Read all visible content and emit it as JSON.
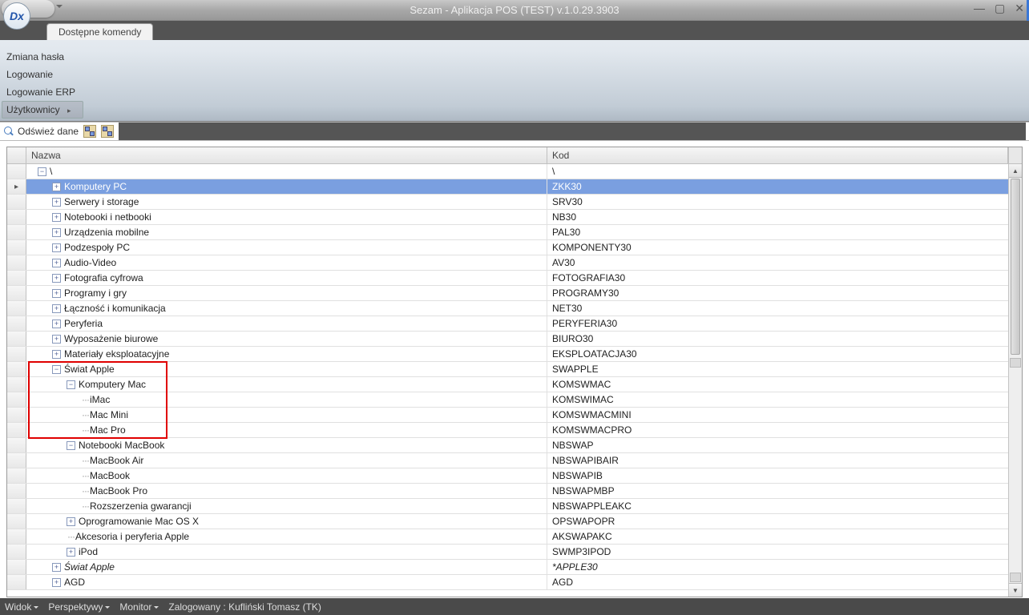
{
  "title": "Sezam - Aplikacja POS (TEST) v.1.0.29.3903",
  "logo_letters": "Dx",
  "tab": {
    "label": "Dostępne komendy"
  },
  "ribbon_menu": [
    "Zmiana hasła",
    "Logowanie",
    "Logowanie ERP",
    "Użytkownicy"
  ],
  "toolbar": {
    "refresh": "Odśwież dane"
  },
  "grid": {
    "col_nazwa": "Nazwa",
    "col_kod": "Kod",
    "root_label": "\\",
    "root_kod": "\\",
    "rows": [
      {
        "depth": 1,
        "exp": "+",
        "name": "Komputery PC",
        "kod": "ZKK30",
        "selected": true
      },
      {
        "depth": 1,
        "exp": "+",
        "name": "Serwery i storage",
        "kod": "SRV30"
      },
      {
        "depth": 1,
        "exp": "+",
        "name": "Notebooki i netbooki",
        "kod": "NB30"
      },
      {
        "depth": 1,
        "exp": "+",
        "name": "Urządzenia mobilne",
        "kod": "PAL30"
      },
      {
        "depth": 1,
        "exp": "+",
        "name": "Podzespoły PC",
        "kod": "KOMPONENTY30"
      },
      {
        "depth": 1,
        "exp": "+",
        "name": "Audio-Video",
        "kod": "AV30"
      },
      {
        "depth": 1,
        "exp": "+",
        "name": "Fotografia cyfrowa",
        "kod": "FOTOGRAFIA30"
      },
      {
        "depth": 1,
        "exp": "+",
        "name": "Programy i gry",
        "kod": "PROGRAMY30"
      },
      {
        "depth": 1,
        "exp": "+",
        "name": "Łączność i komunikacja",
        "kod": "NET30"
      },
      {
        "depth": 1,
        "exp": "+",
        "name": "Peryferia",
        "kod": "PERYFERIA30"
      },
      {
        "depth": 1,
        "exp": "+",
        "name": "Wyposażenie biurowe",
        "kod": "BIURO30"
      },
      {
        "depth": 1,
        "exp": "+",
        "name": "Materiały eksploatacyjne",
        "kod": "EKSPLOATACJA30"
      },
      {
        "depth": 1,
        "exp": "-",
        "name": "Świat Apple",
        "kod": "SWAPPLE"
      },
      {
        "depth": 2,
        "exp": "-",
        "name": "Komputery Mac",
        "kod": "KOMSWMAC"
      },
      {
        "depth": 3,
        "exp": "",
        "name": "iMac",
        "kod": "KOMSWIMAC"
      },
      {
        "depth": 3,
        "exp": "",
        "name": "Mac Mini",
        "kod": "KOMSWMACMINI"
      },
      {
        "depth": 3,
        "exp": "",
        "name": "Mac Pro",
        "kod": "KOMSWMACPRO"
      },
      {
        "depth": 2,
        "exp": "-",
        "name": "Notebooki MacBook",
        "kod": "NBSWAP"
      },
      {
        "depth": 3,
        "exp": "",
        "name": "MacBook Air",
        "kod": "NBSWAPIBAIR"
      },
      {
        "depth": 3,
        "exp": "",
        "name": "MacBook",
        "kod": "NBSWAPIB"
      },
      {
        "depth": 3,
        "exp": "",
        "name": "MacBook Pro",
        "kod": "NBSWAPMBP"
      },
      {
        "depth": 3,
        "exp": "",
        "name": "Rozszerzenia gwarancji",
        "kod": "NBSWAPPLEAKC"
      },
      {
        "depth": 2,
        "exp": "+",
        "name": "Oprogramowanie Mac OS X",
        "kod": "OPSWAPOPR"
      },
      {
        "depth": 2,
        "exp": "",
        "name": "Akcesoria i peryferia Apple",
        "kod": "AKSWAPAKC"
      },
      {
        "depth": 2,
        "exp": "+",
        "name": "iPod",
        "kod": "SWMP3IPOD"
      },
      {
        "depth": 1,
        "exp": "+",
        "name": "Świat Apple",
        "kod": "*APPLE30",
        "italic": true
      },
      {
        "depth": 1,
        "exp": "+",
        "name": "AGD",
        "kod": "AGD"
      }
    ]
  },
  "statusbar": {
    "widok": "Widok",
    "perspektywy": "Perspektywy",
    "monitor": "Monitor",
    "zalogowany": "Zalogowany : Kufliński Tomasz (TK)"
  }
}
